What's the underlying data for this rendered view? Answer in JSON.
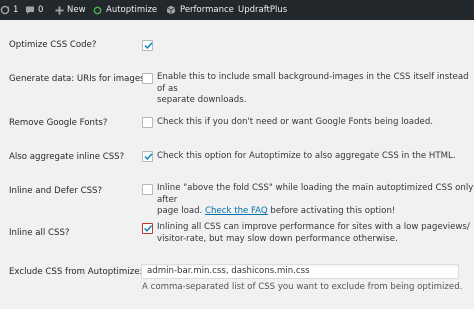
{
  "adminbar": {
    "updates_count": "1",
    "comments_count": "0",
    "new_label": "New",
    "autoptimize_label": "Autoptimize",
    "performance_label": "Performance",
    "updraftplus_label": "UpdraftPlus",
    "autoptimize_status_color": "#46b450"
  },
  "settings": {
    "optimize_css": {
      "label": "Optimize CSS Code?",
      "checked": true
    },
    "data_uris": {
      "label": "Generate data: URIs for images?",
      "checked": false,
      "line1": "Enable this to include small background-images in the CSS itself instead of as",
      "line2": "separate downloads."
    },
    "google_fonts": {
      "label": "Remove Google Fonts?",
      "checked": false,
      "line1": "Check this if you don't need or want Google Fonts being loaded."
    },
    "aggregate_inline": {
      "label": "Also aggregate inline CSS?",
      "checked": true,
      "line1": "Check this option for Autoptimize to also aggregate CSS in the HTML."
    },
    "inline_defer": {
      "label": "Inline and Defer CSS?",
      "checked": false,
      "line1": "Inline \"above the fold CSS\" while loading the main autoptimized CSS only after",
      "line2_pre": "page load. ",
      "line2_link": "Check the FAQ",
      "line2_post": " before activating this option!"
    },
    "inline_all": {
      "label": "Inline all CSS?",
      "checked": true,
      "line1": "Inlining all CSS can improve performance for sites with a low pageviews/",
      "line2": "visitor-rate, but may slow down performance otherwise."
    },
    "exclude": {
      "label": "Exclude CSS from Autoptimize:",
      "value": "admin-bar.min.css, dashicons.min.css",
      "help": "A comma-separated list of CSS you want to exclude from being optimized."
    }
  }
}
